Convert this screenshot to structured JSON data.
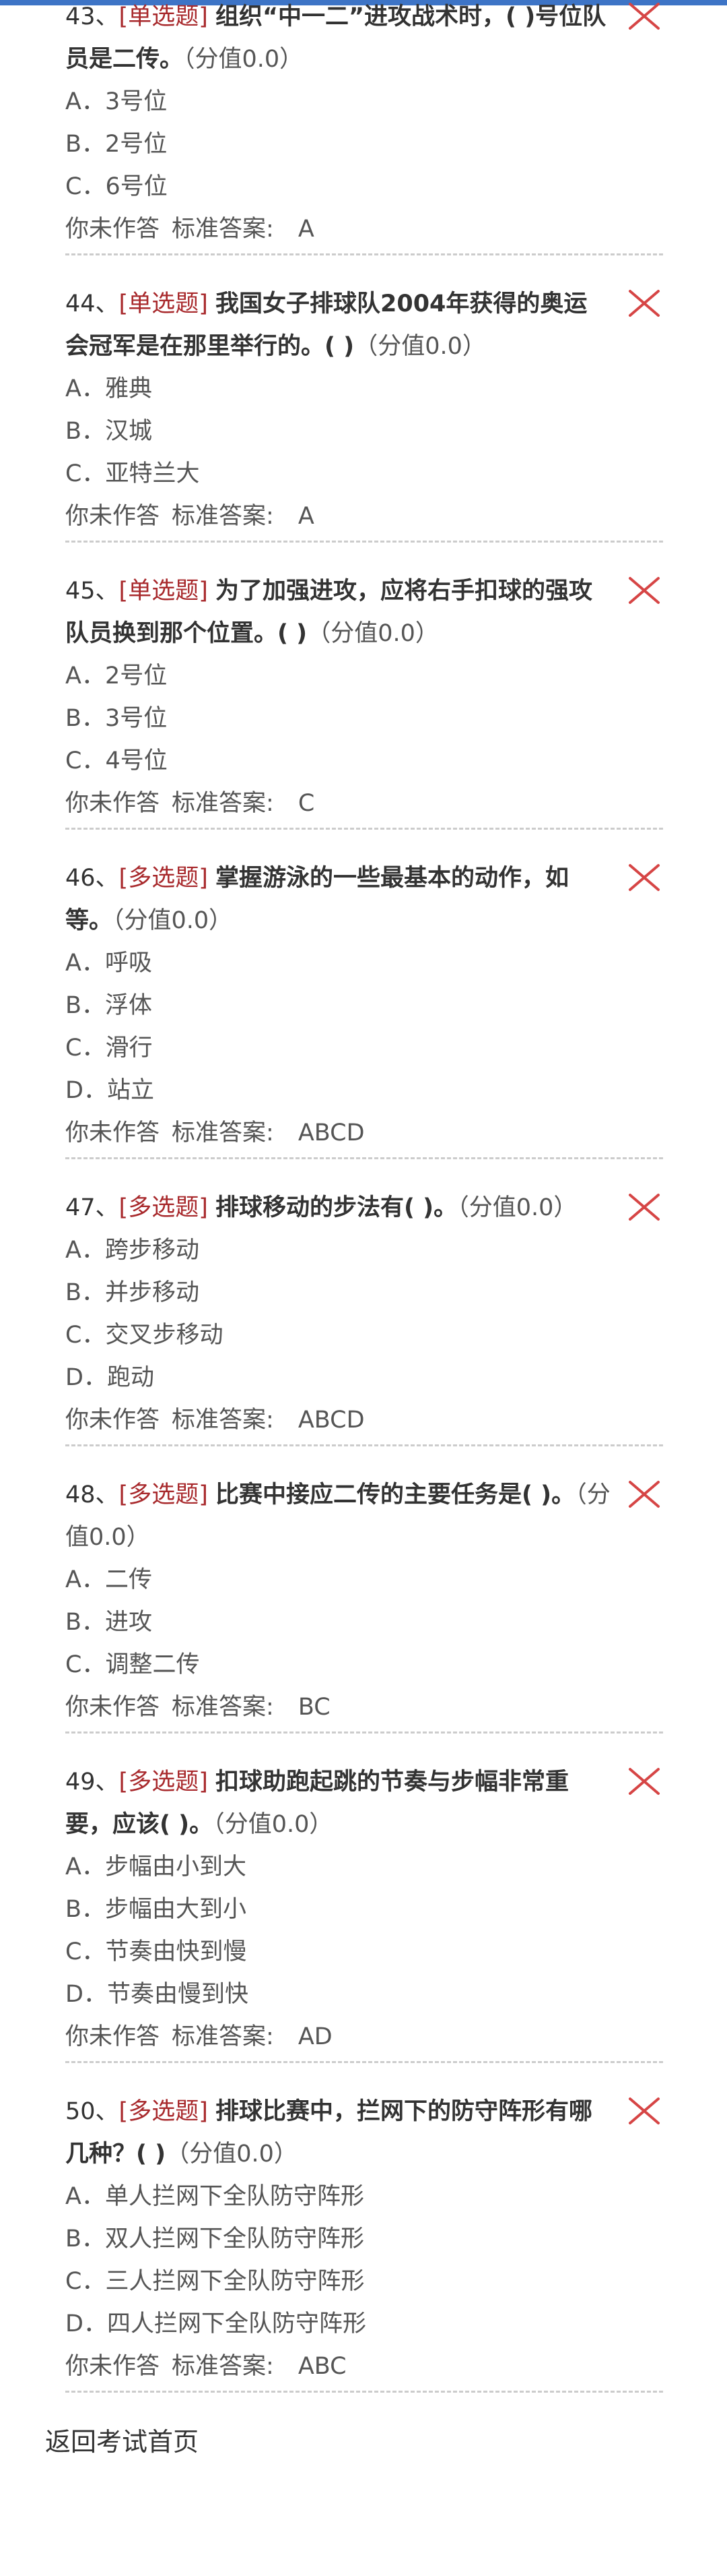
{
  "questions": [
    {
      "number": "43、",
      "type": "[单选题]",
      "stem": "组织“中一二”进攻战术时，( )号位队员是二传。",
      "score": "（分值0.0）",
      "options": [
        "A．3号位",
        "B．2号位",
        "C．6号位"
      ],
      "status": "你未作答",
      "answer_label": "标准答案:",
      "answer": "A"
    },
    {
      "number": "44、",
      "type": "[单选题]",
      "stem": "我国女子排球队2004年获得的奥运会冠军是在那里举行的。( )",
      "score": "（分值0.0）",
      "options": [
        "A．雅典",
        "B．汉城",
        "C．亚特兰大"
      ],
      "status": "你未作答",
      "answer_label": "标准答案:",
      "answer": "A"
    },
    {
      "number": "45、",
      "type": "[单选题]",
      "stem": "为了加强进攻，应将右手扣球的强攻队员换到那个位置。( )",
      "score": "（分值0.0）",
      "options": [
        "A．2号位",
        "B．3号位",
        "C．4号位"
      ],
      "status": "你未作答",
      "answer_label": "标准答案:",
      "answer": "C"
    },
    {
      "number": "46、",
      "type": "[多选题]",
      "stem": "掌握游泳的一些最基本的动作，如　　　等。",
      "score": "（分值0.0）",
      "options": [
        "A．呼吸",
        "B．浮体",
        "C．滑行",
        "D．站立"
      ],
      "status": "你未作答",
      "answer_label": "标准答案:",
      "answer": "ABCD"
    },
    {
      "number": "47、",
      "type": "[多选题]",
      "stem": "排球移动的步法有( )。",
      "score": "（分值0.0）",
      "options": [
        "A．跨步移动",
        "B．并步移动",
        "C．交叉步移动",
        "D．跑动"
      ],
      "status": "你未作答",
      "answer_label": "标准答案:",
      "answer": "ABCD"
    },
    {
      "number": "48、",
      "type": "[多选题]",
      "stem": "比赛中接应二传的主要任务是( )。",
      "score": "（分值0.0）",
      "options": [
        "A．二传",
        "B．进攻",
        "C．调整二传"
      ],
      "status": "你未作答",
      "answer_label": "标准答案:",
      "answer": "BC"
    },
    {
      "number": "49、",
      "type": "[多选题]",
      "stem": "扣球助跑起跳的节奏与步幅非常重要，应该( )。",
      "score": "（分值0.0）",
      "options": [
        "A．步幅由小到大",
        "B．步幅由大到小",
        "C．节奏由快到慢",
        "D．节奏由慢到快"
      ],
      "status": "你未作答",
      "answer_label": "标准答案:",
      "answer": "AD"
    },
    {
      "number": "50、",
      "type": "[多选题]",
      "stem": "排球比赛中，拦网下的防守阵形有哪几种？( )",
      "score": "（分值0.0）",
      "options": [
        "A．单人拦网下全队防守阵形",
        "B．双人拦网下全队防守阵形",
        "C．三人拦网下全队防守阵形",
        "D．四人拦网下全队防守阵形"
      ],
      "status": "你未作答",
      "answer_label": "标准答案:",
      "answer": "ABC"
    }
  ],
  "footer": {
    "back_link": "返回考试首页"
  },
  "colors": {
    "top_bar": "#3d74c6",
    "question_type": "#a8292c",
    "wrong_icon": "#d64545",
    "divider": "#cccccc"
  }
}
